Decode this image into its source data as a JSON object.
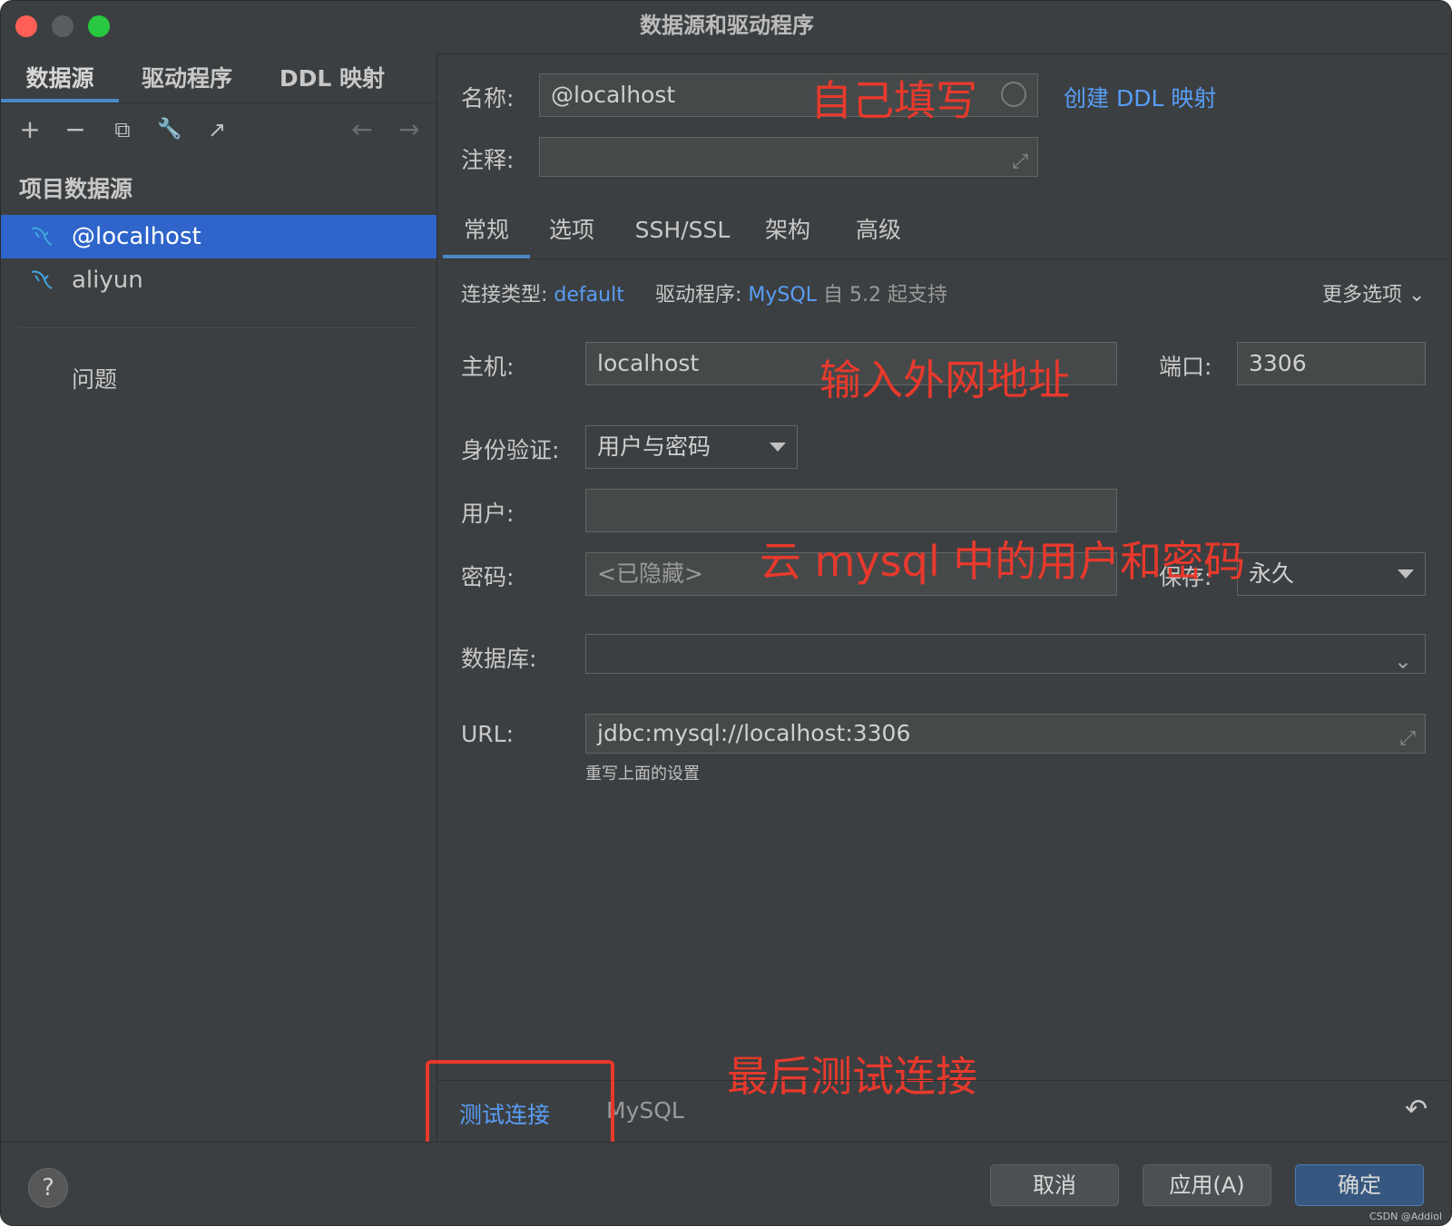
{
  "window": {
    "title": "数据源和驱动程序"
  },
  "left": {
    "tabs": [
      "数据源",
      "驱动程序",
      "DDL 映射"
    ],
    "toolbar": {
      "add": "+",
      "remove": "−",
      "copy": "⧉",
      "settings": "🔧",
      "export": "↗",
      "back": "←",
      "forward": "→"
    },
    "section_title": "项目数据源",
    "items": [
      {
        "label": "@localhost",
        "selected": true
      },
      {
        "label": "aliyun",
        "selected": false
      }
    ],
    "problems": "问题"
  },
  "form": {
    "name_label": "名称:",
    "name_value": "@localhost",
    "create_ddl": "创建 DDL 映射",
    "comment_label": "注释:",
    "comment_value": "",
    "tabs": [
      "常规",
      "选项",
      "SSH/SSL",
      "架构",
      "高级"
    ],
    "conn_type_label": "连接类型:",
    "conn_type_value": "default",
    "driver_label": "驱动程序:",
    "driver_value": "MySQL",
    "driver_support": "自 5.2 起支持",
    "more_options": "更多选项",
    "host_label": "主机:",
    "host_value": "localhost",
    "port_label": "端口:",
    "port_value": "3306",
    "auth_label": "身份验证:",
    "auth_value": "用户与密码",
    "user_label": "用户:",
    "user_value": "",
    "password_label": "密码:",
    "password_placeholder": "<已隐藏>",
    "save_label": "保存:",
    "save_value": "永久",
    "database_label": "数据库:",
    "database_value": "",
    "url_label": "URL:",
    "url_value": "jdbc:mysql://localhost:3306",
    "url_hint": "重写上面的设置"
  },
  "bottom": {
    "test_connection": "测试连接",
    "driver_name": "MySQL",
    "revert_icon": "↶"
  },
  "footer": {
    "help": "?",
    "cancel": "取消",
    "apply": "应用(A)",
    "ok": "确定"
  },
  "annotations": {
    "name_note": "自己填写",
    "host_note": "输入外网地址",
    "cred_note": "云 mysql 中的用户和密码",
    "test_note": "最后测试连接"
  },
  "watermark": "CSDN @Addiol",
  "colors": {
    "accent": "#4a88c7",
    "link": "#589df6",
    "selection": "#2f65ca",
    "annotation": "#e8392c"
  }
}
